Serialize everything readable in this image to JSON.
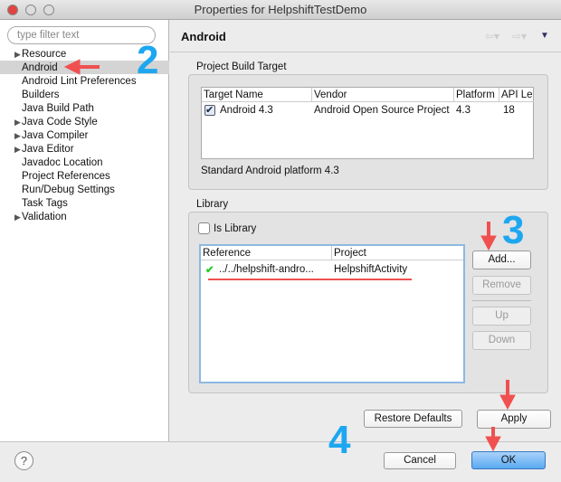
{
  "window": {
    "title": "Properties for HelpshiftTestDemo"
  },
  "sidebar": {
    "filter_placeholder": "type filter text",
    "items": [
      {
        "label": "Resource",
        "expandable": true
      },
      {
        "label": "Android",
        "selected": true
      },
      {
        "label": "Android Lint Preferences"
      },
      {
        "label": "Builders"
      },
      {
        "label": "Java Build Path"
      },
      {
        "label": "Java Code Style",
        "expandable": true
      },
      {
        "label": "Java Compiler",
        "expandable": true
      },
      {
        "label": "Java Editor",
        "expandable": true
      },
      {
        "label": "Javadoc Location"
      },
      {
        "label": "Project References"
      },
      {
        "label": "Run/Debug Settings"
      },
      {
        "label": "Task Tags"
      },
      {
        "label": "Validation",
        "expandable": true
      }
    ]
  },
  "main": {
    "title": "Android",
    "build_target": {
      "label": "Project Build Target",
      "columns": [
        "Target Name",
        "Vendor",
        "Platform",
        "API Le"
      ],
      "rows": [
        {
          "checked": true,
          "name": "Android 4.3",
          "vendor": "Android Open Source Project",
          "platform": "4.3",
          "api": "18"
        }
      ],
      "description": "Standard Android platform 4.3"
    },
    "library": {
      "label": "Library",
      "is_library_label": "Is Library",
      "is_library": false,
      "columns": [
        "Reference",
        "Project"
      ],
      "rows": [
        {
          "reference": "../../helpshift-andro...",
          "project": "HelpshiftActivity"
        }
      ],
      "buttons": {
        "add": "Add...",
        "remove": "Remove",
        "up": "Up",
        "down": "Down"
      }
    },
    "restore_defaults": "Restore Defaults",
    "apply": "Apply"
  },
  "footer": {
    "cancel": "Cancel",
    "ok": "OK",
    "help": "?"
  },
  "annotations": {
    "step2": "2",
    "step3": "3",
    "step4": "4"
  },
  "colors": {
    "annotation_blue": "#1ea7f0",
    "annotation_red": "#f05050",
    "ok_blue": "#5aa9f0"
  }
}
